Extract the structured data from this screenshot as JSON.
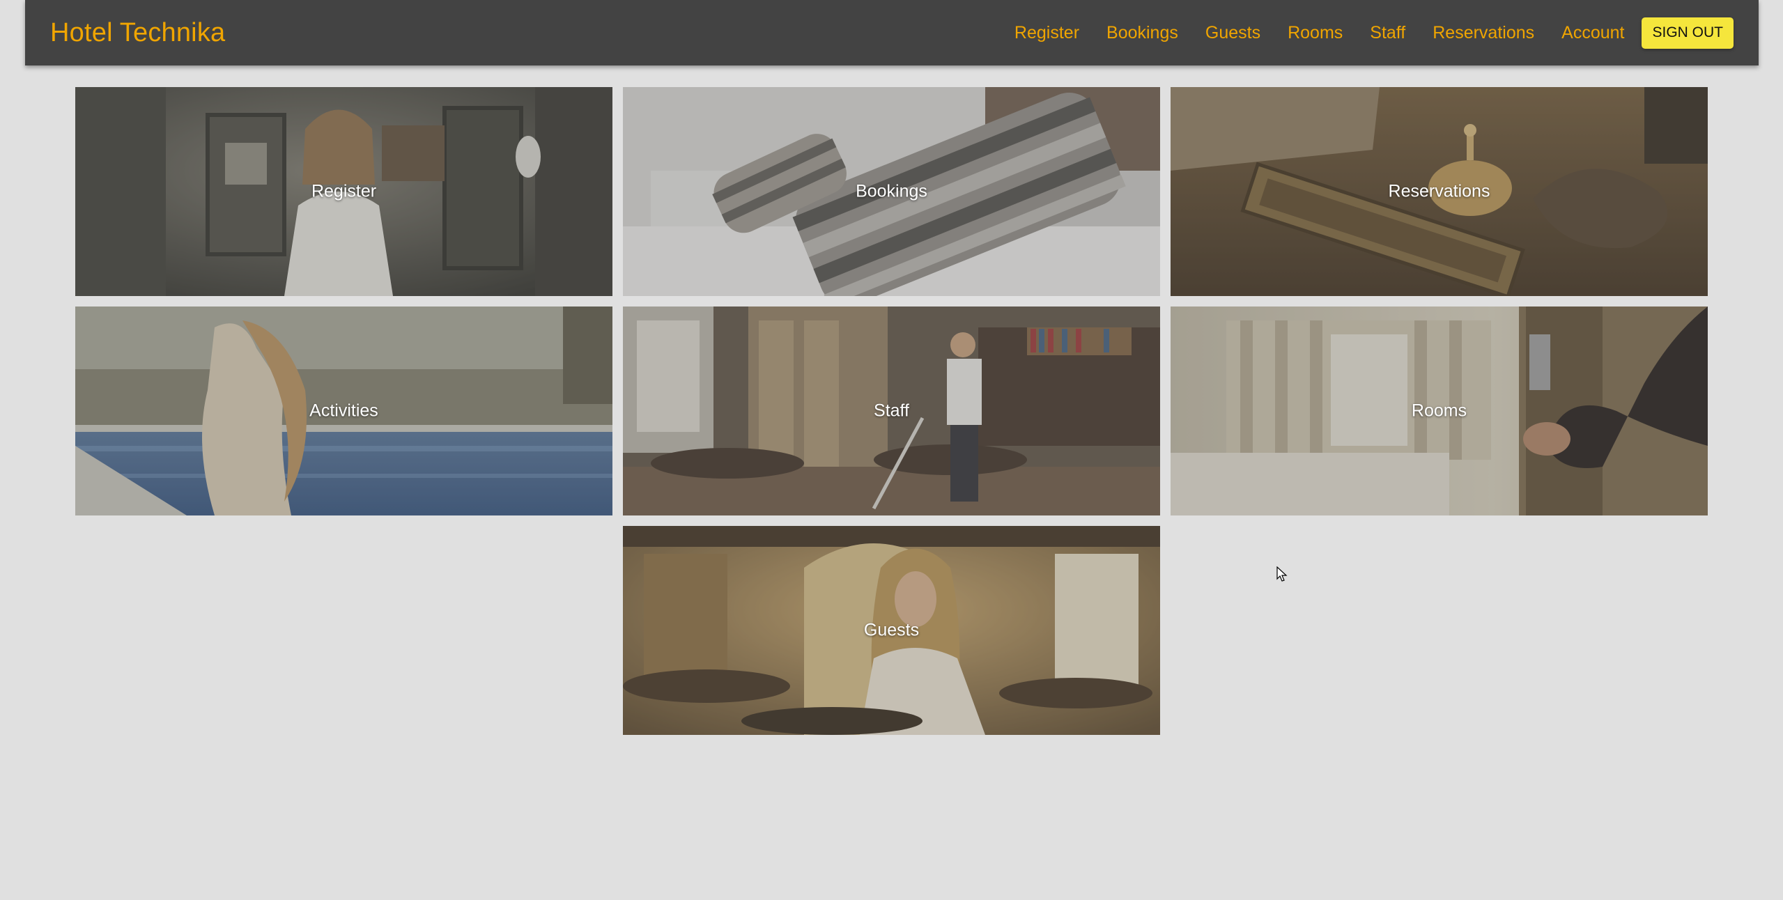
{
  "brand": {
    "name": "Hotel Technika"
  },
  "nav": {
    "links": [
      "Register",
      "Bookings",
      "Guests",
      "Rooms",
      "Staff",
      "Reservations",
      "Account"
    ],
    "signout_label": "SIGN OUT"
  },
  "tiles": {
    "register": "Register",
    "bookings": "Bookings",
    "reservations": "Reservations",
    "activities": "Activities",
    "staff": "Staff",
    "rooms": "Rooms",
    "guests": "Guests"
  },
  "colors": {
    "navbar_bg": "#434343",
    "accent": "#f0a500",
    "signout_bg": "#f5e63c",
    "page_bg": "#e0e0e0"
  }
}
